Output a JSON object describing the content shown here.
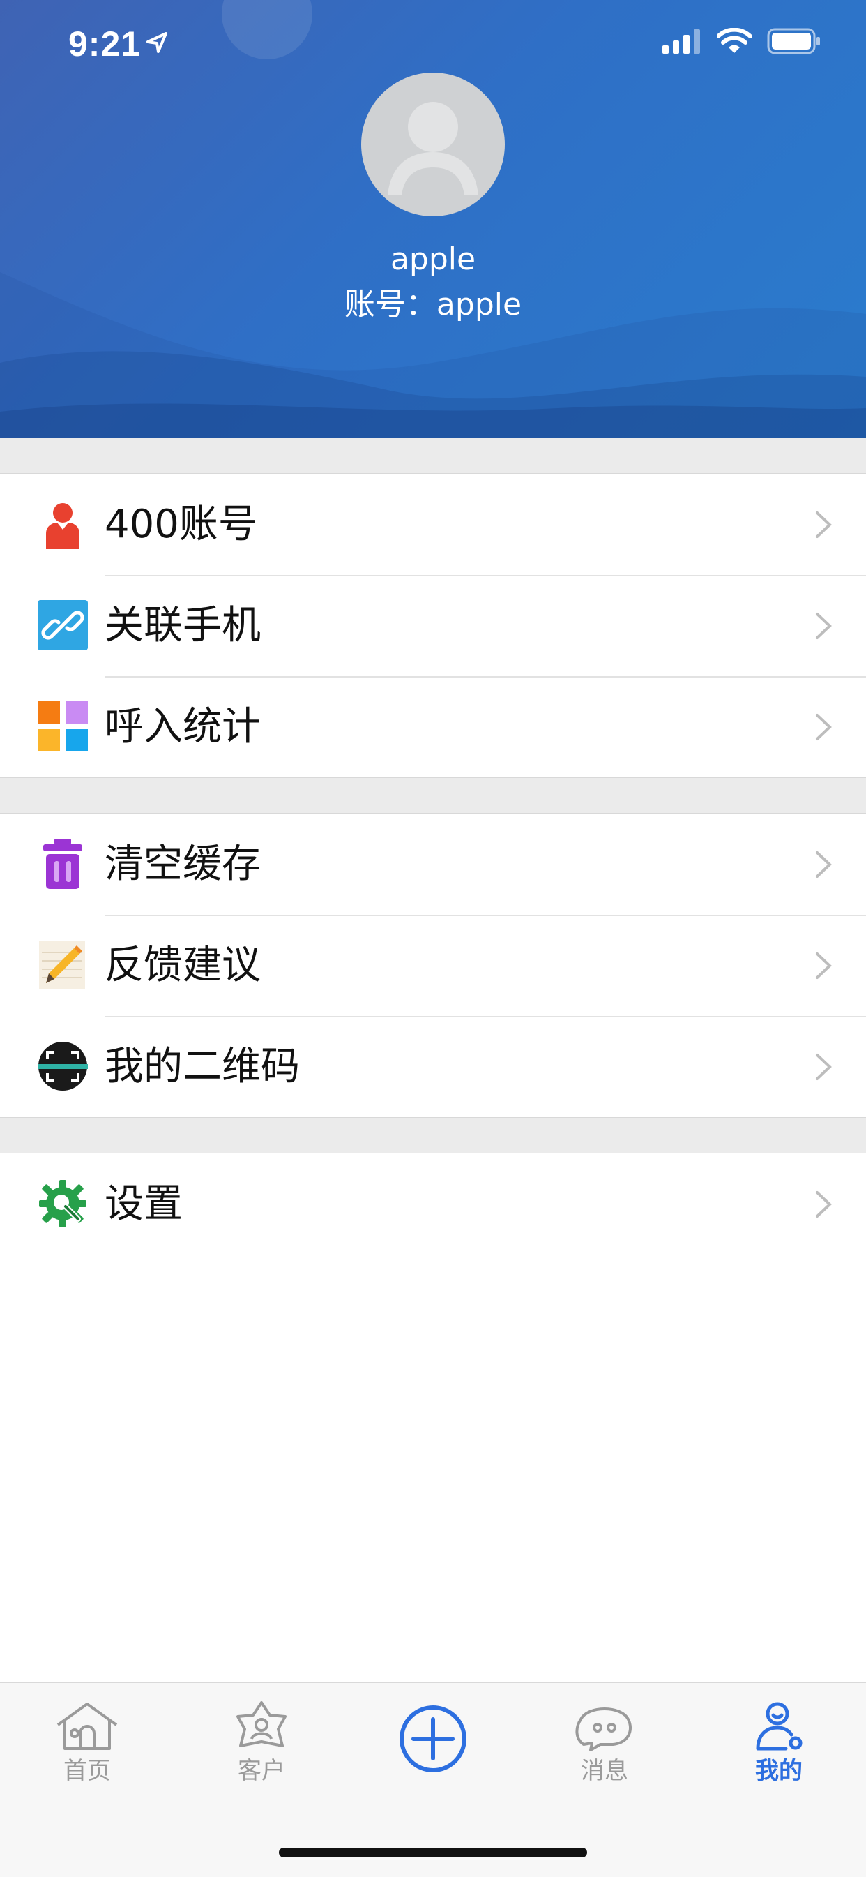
{
  "status_bar": {
    "time": "9:21"
  },
  "profile": {
    "username": "apple",
    "account_line": "账号：apple"
  },
  "menu": {
    "group1": [
      {
        "label": "400账号",
        "icon": "person-icon"
      },
      {
        "label": "关联手机",
        "icon": "link-icon"
      },
      {
        "label": "呼入统计",
        "icon": "grid-stats-icon"
      }
    ],
    "group2": [
      {
        "label": "清空缓存",
        "icon": "trash-icon"
      },
      {
        "label": "反馈建议",
        "icon": "pencil-note-icon"
      },
      {
        "label": "我的二维码",
        "icon": "qr-scan-icon"
      }
    ],
    "group3": [
      {
        "label": "设置",
        "icon": "gear-wrench-icon"
      }
    ]
  },
  "tabbar": {
    "home": "首页",
    "customers": "客户",
    "messages": "消息",
    "mine": "我的",
    "active": "mine"
  },
  "colors": {
    "header_blue": "#2f6fc6",
    "active_tab": "#2d6fe0",
    "person_red": "#e8412f",
    "link_blue": "#2fa6e3",
    "trash_purple": "#9b34d4",
    "settings_green": "#27a04a"
  }
}
